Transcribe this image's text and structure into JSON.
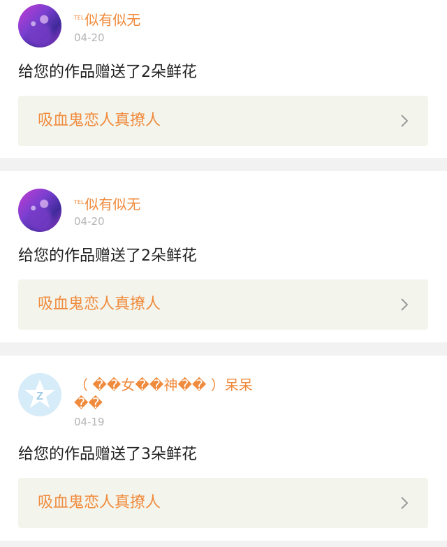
{
  "items": [
    {
      "tel_prefix": "TEL",
      "username": "似有似无",
      "date": "04-20",
      "message": "给您的作品赠送了2朵鲜花",
      "work_title": "吸血鬼恋人真撩人",
      "avatar": "user-photo-avatar"
    },
    {
      "tel_prefix": "TEL",
      "username": "似有似无",
      "date": "04-20",
      "message": "给您的作品赠送了2朵鲜花",
      "work_title": "吸血鬼恋人真撩人",
      "avatar": "user-photo-avatar"
    },
    {
      "username_line1": "（ ��女��神�� ）呆呆",
      "username_line2": "��",
      "date": "04-19",
      "message": "给您的作品赠送了3朵鲜花",
      "work_title": "吸血鬼恋人真撩人",
      "avatar": "qzone-star-avatar"
    }
  ],
  "colors": {
    "accent": "#f08a3c",
    "date": "#b4b4b4",
    "work_bg": "#f3f5ed",
    "page_bg": "#f2f2f2"
  },
  "icons": {
    "chevron": "chevron-right-icon"
  }
}
